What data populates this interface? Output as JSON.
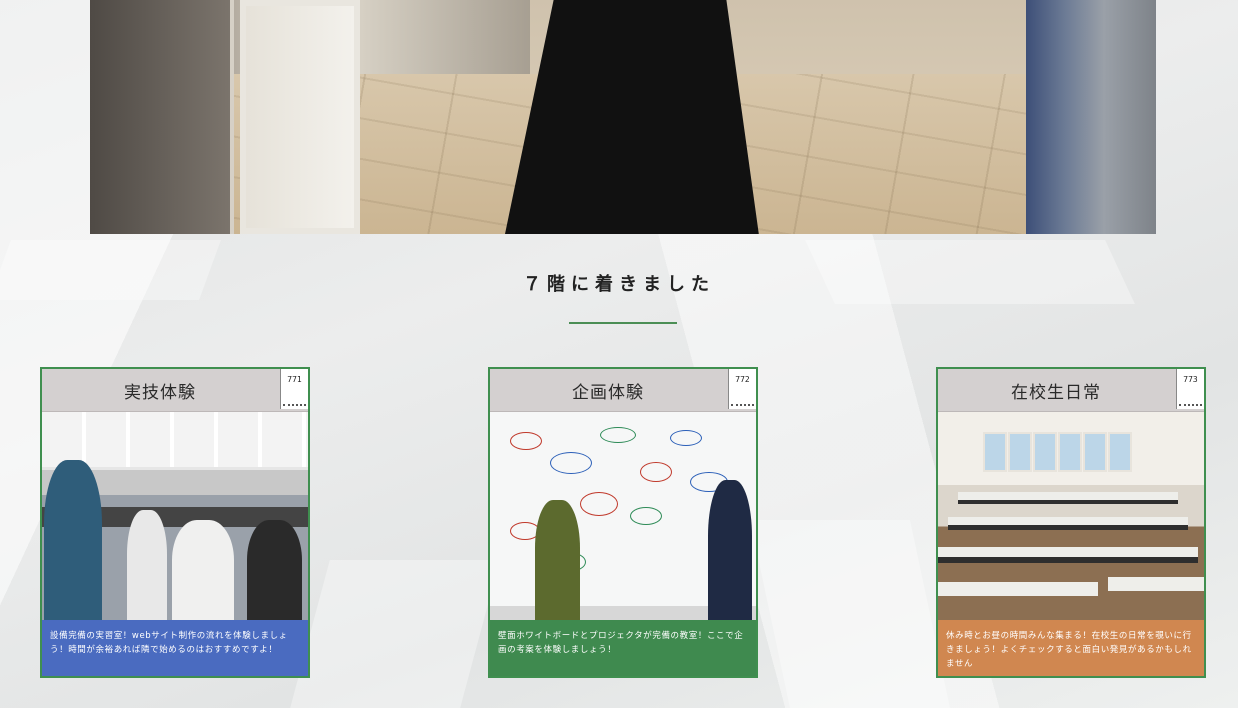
{
  "section": {
    "title": "７階に着きました"
  },
  "cards": [
    {
      "title": "実技体験",
      "room": "771",
      "description": "設備完備の実習室！webサイト制作の流れを体験しましょう！時間が余裕あれば隣で始めるのはおすすめですよ！",
      "desc_bg": "#4a6bc0"
    },
    {
      "title": "企画体験",
      "room": "772",
      "description": "壁面ホワイトボードとプロジェクタが完備の教室！ここで企画の考案を体験しましょう！",
      "desc_bg": "#3f8a4f"
    },
    {
      "title": "在校生日常",
      "room": "773",
      "description": "休み時とお昼の時間みんな集まる！在校生の日常を覗いに行きましょう！よくチェックすると面白い発見があるかもしれません",
      "desc_bg": "#d08750"
    }
  ],
  "colors": {
    "accent_line": "#4b8e55",
    "card_border": "#3f8f4f"
  }
}
